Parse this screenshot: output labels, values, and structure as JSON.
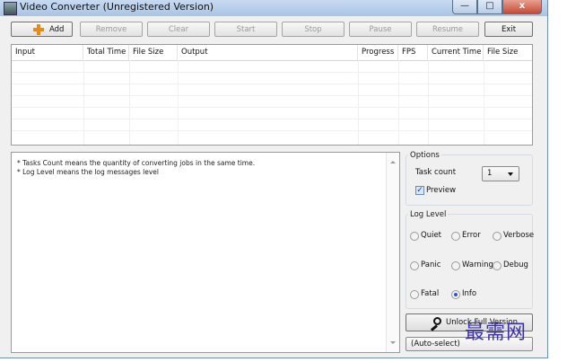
{
  "window": {
    "title": "Video Converter  (Unregistered Version)",
    "controls": {
      "minimize": "—",
      "maximize": "□",
      "close": "x"
    }
  },
  "toolbar": {
    "buttons": [
      {
        "label": "Add",
        "enabled": true,
        "icon": "add-icon"
      },
      {
        "label": "Remove",
        "enabled": false
      },
      {
        "label": "Clear",
        "enabled": false
      },
      {
        "label": "Start",
        "enabled": false
      },
      {
        "label": "Stop",
        "enabled": false
      },
      {
        "label": "Pause",
        "enabled": false
      },
      {
        "label": "Resume",
        "enabled": false
      },
      {
        "label": "Exit",
        "enabled": true
      }
    ]
  },
  "jobs_table": {
    "columns": [
      "Input",
      "Total Time",
      "File Size",
      "Output",
      "Progress",
      "FPS",
      "Current Time",
      "File Size"
    ],
    "rows": []
  },
  "log": {
    "lines": [
      " * Tasks Count means the quantity of converting jobs in the same time.",
      "* Log Level means the log messages level"
    ]
  },
  "options": {
    "group_label": "Options",
    "task_count_label": "Task count",
    "task_count_value": "1",
    "preview_label": "Preview",
    "preview_checked": true
  },
  "log_level": {
    "group_label": "Log Level",
    "levels": [
      "Quiet",
      "Error",
      "Verbose",
      "Panic",
      "Warning",
      "Debug",
      "Fatal",
      "Info"
    ],
    "selected": "Info"
  },
  "unlock_button": {
    "label": "Unlock Full Version",
    "icon": "key-icon"
  },
  "codec_select": {
    "value": "(Auto-select)"
  },
  "watermark": {
    "text": "最需网"
  },
  "colors": {
    "window_bg": "#f0f0f0",
    "titlebar": "#b9d1ea",
    "close_button": "#c44a34",
    "watermark": "#3b2fb4",
    "add_icon": "#e58a1b"
  }
}
